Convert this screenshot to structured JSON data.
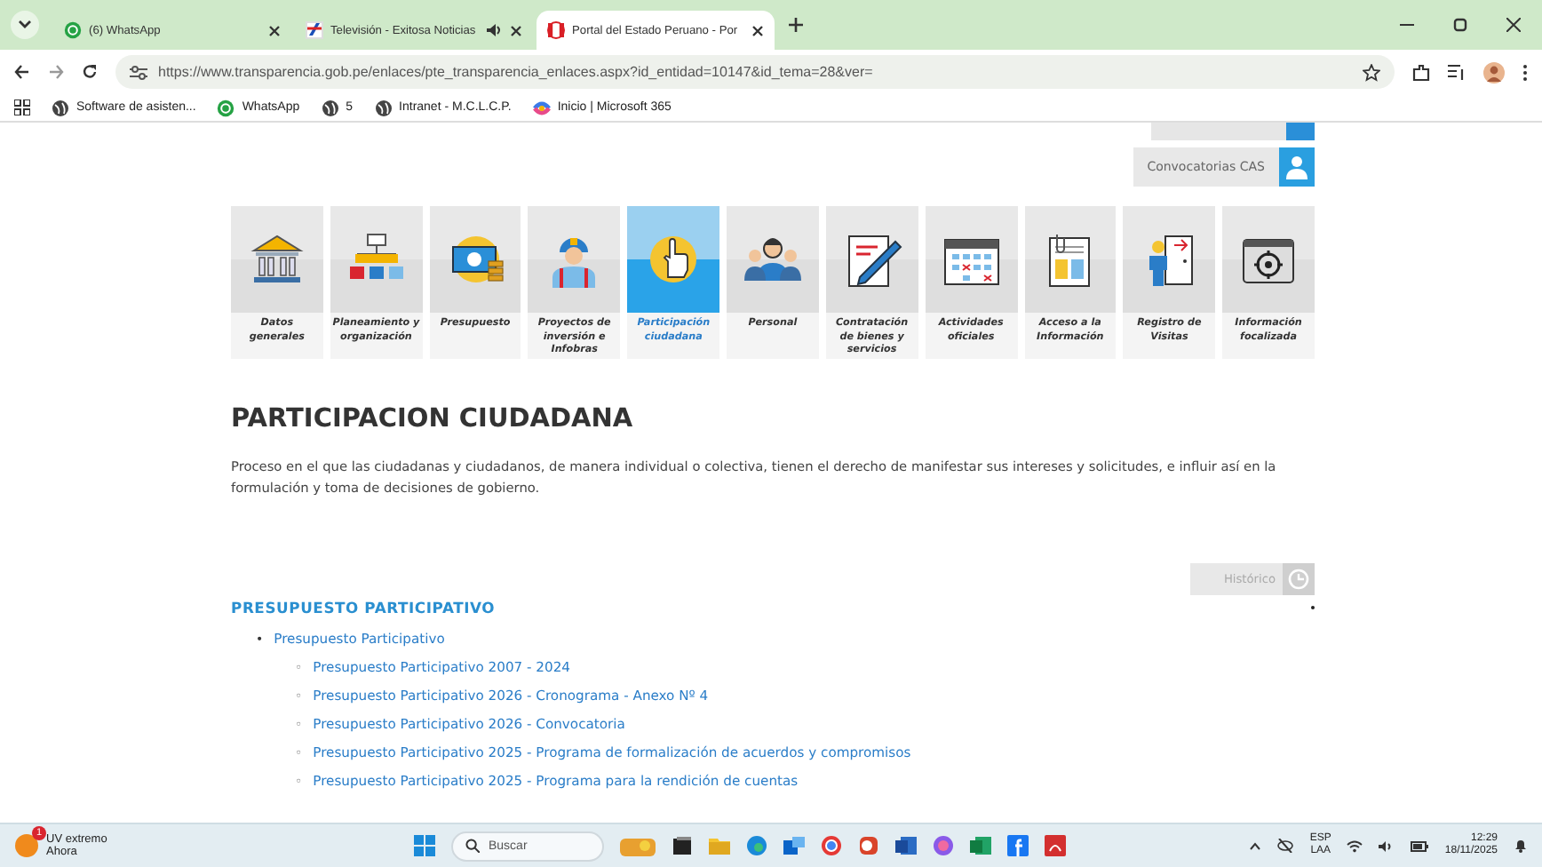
{
  "browser": {
    "tabs": [
      {
        "kind": "whatsapp",
        "title": "(6) WhatsApp",
        "selected": false,
        "audio": false
      },
      {
        "kind": "tv",
        "title": "Televisión - Exitosa Noticias",
        "selected": false,
        "audio": true
      },
      {
        "kind": "flag",
        "title": "Portal del Estado Peruano - Por",
        "selected": true,
        "audio": false
      }
    ],
    "address": "https://www.transparencia.gob.pe/enlaces/pte_transparencia_enlaces.aspx?id_entidad=10147&id_tema=28&ver=",
    "bookmarks": [
      {
        "kind": "globe",
        "label": "Software de asisten..."
      },
      {
        "kind": "whatsapp",
        "label": "WhatsApp"
      },
      {
        "kind": "globe",
        "label": "5"
      },
      {
        "kind": "globe",
        "label": "Intranet - M.C.L.C.P."
      },
      {
        "kind": "m365",
        "label": "Inicio | Microsoft 365"
      }
    ]
  },
  "page": {
    "side_buttons": [
      {
        "label": "Convocatorias CAS"
      }
    ],
    "categories": [
      {
        "label": "Datos generales",
        "selected": false
      },
      {
        "label": "Planeamiento y organización",
        "selected": false
      },
      {
        "label": "Presupuesto",
        "selected": false
      },
      {
        "label": "Proyectos de inversión e Infobras",
        "selected": false
      },
      {
        "label": "Participación ciudadana",
        "selected": true
      },
      {
        "label": "Personal",
        "selected": false
      },
      {
        "label": "Contratación de bienes y servicios",
        "selected": false
      },
      {
        "label": "Actividades oficiales",
        "selected": false
      },
      {
        "label": "Acceso a la Información",
        "selected": false
      },
      {
        "label": "Registro de Visitas",
        "selected": false
      },
      {
        "label": "Información focalizada",
        "selected": false
      }
    ],
    "title": "PARTICIPACION CIUDADANA",
    "description": "Proceso en el que las ciudadanas y ciudadanos, de manera individual o colectiva, tienen el derecho de manifestar sus intereses y solicitudes, e influir así en la formulación y toma de decisiones de gobierno.",
    "history_button": "Histórico",
    "section_heading": "PRESUPUESTO PARTICIPATIVO",
    "links": [
      {
        "marker": "•",
        "label": "Presupuesto Participativo",
        "children": [
          {
            "marker": "◦",
            "label": "Presupuesto Participativo 2007 - 2024"
          },
          {
            "marker": "◦",
            "label": "Presupuesto Participativo 2026 - Cronograma - Anexo Nº 4"
          },
          {
            "marker": "◦",
            "label": "Presupuesto Participativo 2026 - Convocatoria"
          },
          {
            "marker": "◦",
            "label": "Presupuesto Participativo 2025 - Programa de formalización de acuerdos y compromisos"
          },
          {
            "marker": "◦",
            "label": "Presupuesto Participativo 2025 - Programa para la rendición de cuentas"
          }
        ]
      }
    ]
  },
  "taskbar": {
    "weather": {
      "badge": "1",
      "condition": "UV extremo",
      "time": "Ahora"
    },
    "search": {
      "placeholder": "Buscar"
    },
    "language": [
      "ESP",
      "LAA"
    ],
    "clock": {
      "time": "12:29",
      "date": "18/11/2025"
    }
  }
}
